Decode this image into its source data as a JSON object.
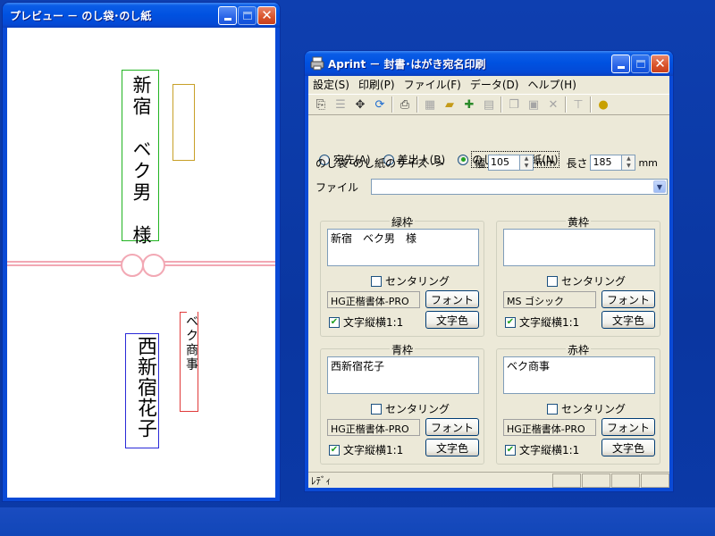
{
  "preview_window": {
    "title": "プレビュー － のし袋･のし紙",
    "green_box_text": "新宿　ベク男　様",
    "yellow_box_text": "",
    "blue_box_text": "西新宿花子",
    "red_box_text": "ベク商事",
    "colors": {
      "green": "#22b422",
      "yellow": "#c8a028",
      "blue": "#2a2ad8",
      "red": "#e03a3a",
      "ribbon": "#f2a8b4"
    }
  },
  "aprint_window": {
    "title": "Aprint － 封書･はがき宛名印刷",
    "menu": [
      "設定(S)",
      "印刷(P)",
      "ファイル(F)",
      "データ(D)",
      "ヘルプ(H)"
    ],
    "toolbar_icons": [
      "page-setup-icon",
      "list-icon",
      "move-icon",
      "refresh-icon",
      "print-icon",
      "table-icon",
      "open-icon",
      "add-icon",
      "save-icon",
      "copy-icon",
      "paste-icon",
      "delete-icon",
      "filter-icon",
      "bulb-icon"
    ],
    "modes": [
      {
        "label": "宛先(A)",
        "selected": false
      },
      {
        "label": "差出人(B)",
        "selected": false
      },
      {
        "label": "のし袋･のし紙(N)",
        "selected": true
      }
    ],
    "size_label": "のし袋･のし紙のサイズ ->",
    "width_label": "幅",
    "width_value": "105",
    "height_label": "長さ",
    "height_value": "185",
    "unit": "mm",
    "file_label": "ファイル",
    "file_value": "",
    "groups": {
      "green": {
        "title": "緑枠",
        "text": "新宿　ベク男　様",
        "centering_label": "センタリング",
        "centering": false,
        "font": "HG正楷書体-PRO",
        "font_button": "フォント",
        "ratio_label": "文字縦横1:1",
        "ratio": true,
        "color_button": "文字色"
      },
      "yellow": {
        "title": "黄枠",
        "text": "",
        "centering_label": "センタリング",
        "centering": false,
        "font": "MS ゴシック",
        "font_button": "フォント",
        "ratio_label": "文字縦横1:1",
        "ratio": true,
        "color_button": "文字色"
      },
      "blue": {
        "title": "青枠",
        "text": "西新宿花子",
        "centering_label": "センタリング",
        "centering": false,
        "font": "HG正楷書体-PRO",
        "font_button": "フォント",
        "ratio_label": "文字縦横1:1",
        "ratio": true,
        "color_button": "文字色"
      },
      "red": {
        "title": "赤枠",
        "text": "ベク商事",
        "centering_label": "センタリング",
        "centering": false,
        "font": "HG正楷書体-PRO",
        "font_button": "フォント",
        "ratio_label": "文字縦横1:1",
        "ratio": true,
        "color_button": "文字色"
      }
    },
    "status": "ﾚﾃﾞｨ"
  }
}
